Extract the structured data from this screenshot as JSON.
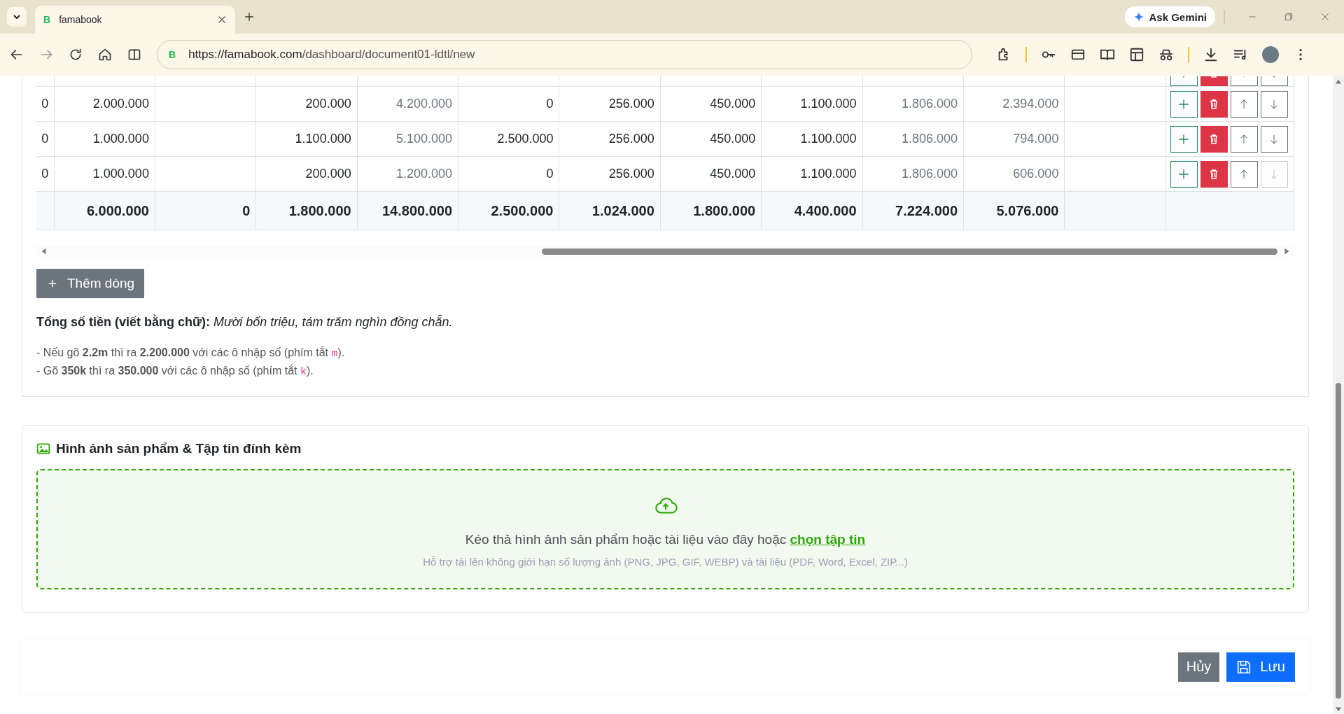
{
  "browser": {
    "tab": {
      "favicon": "B",
      "title": "famabook",
      "selected": true
    },
    "ask_gemini": "Ask Gemini",
    "address": {
      "favicon": "B",
      "host": "https://famabook.com",
      "path": "/dashboard/document01-ldtl/new"
    }
  },
  "table": {
    "columns": [
      {
        "muted": false
      },
      {
        "muted": false
      },
      {
        "muted": false
      },
      {
        "muted": false
      },
      {
        "muted": true
      },
      {
        "muted": false
      },
      {
        "muted": false
      },
      {
        "muted": false
      },
      {
        "muted": false
      },
      {
        "muted": true
      },
      {
        "muted": true
      },
      {
        "muted": false
      }
    ],
    "rows": [
      {
        "cut": true,
        "down_disabled": false
      },
      {
        "cut": false,
        "down_disabled": false,
        "cells": {
          "column_1": "0",
          "column_2": "2.000.000",
          "column_4": "200.000",
          "column_5": "4.200.000",
          "column_6": "0",
          "column_7": "256.000",
          "column_8": "450.000",
          "column_9": "1.100.000",
          "column_10": "1.806.000",
          "column_11": "2.394.000"
        }
      },
      {
        "cut": false,
        "down_disabled": false,
        "cells": {
          "column_1": "0",
          "column_2": "1.000.000",
          "column_4": "1.100.000",
          "column_5": "5.100.000",
          "column_6": "2.500.000",
          "column_7": "256.000",
          "column_8": "450.000",
          "column_9": "1.100.000",
          "column_10": "1.806.000",
          "column_11": "794.000"
        }
      },
      {
        "cut": false,
        "down_disabled": true,
        "cells": {
          "column_1": "0",
          "column_2": "1.000.000",
          "column_4": "200.000",
          "column_5": "1.200.000",
          "column_6": "0",
          "column_7": "256.000",
          "column_8": "450.000",
          "column_9": "1.100.000",
          "column_10": "1.806.000",
          "column_11": "606.000"
        }
      }
    ],
    "totals": {
      "column_2": "6.000.000",
      "column_3": "0",
      "column_4": "1.800.000",
      "column_5": "14.800.000",
      "column_6": "2.500.000",
      "column_7": "1.024.000",
      "column_8": "1.800.000",
      "column_9": "4.400.000",
      "column_10": "7.224.000",
      "column_11": "5.076.000"
    }
  },
  "add_row_button": {
    "label": "Thêm dòng"
  },
  "amount_in_words": "**Tổng số tiền (viết bằng chữ):** *Mười bốn triệu, tám trăm nghìn đồng chẵn.*",
  "notes": [
    {
      "text": "- Nếu gõ **2.2m** thì ra **2.200.000** với các ô nhập số (phím tắt ",
      "shortcut": "m",
      "after": ")."
    },
    {
      "text": "- Gõ **350k** thì ra **350.000** với các ô nhập số (phím tắt ",
      "shortcut": "k",
      "after": ")."
    }
  ],
  "attachments": {
    "title": "Hình ảnh sản phẩm & Tập tin đính kèm",
    "prompt": "Kéo thả hình ảnh sản phẩm hoặc tài liệu vào đây hoặc",
    "link": "chọn tập tin",
    "hint": "Hỗ trợ tải lên không giới hạn số lượng ảnh (PNG, JPG, GIF, WEBP) và tài liệu (PDF, Word, Excel, ZIP...)"
  },
  "footer": {
    "buttons": [
      {
        "kind": "secondary",
        "label": "Hủy"
      },
      {
        "kind": "primary",
        "label": "Lưu"
      }
    ]
  }
}
